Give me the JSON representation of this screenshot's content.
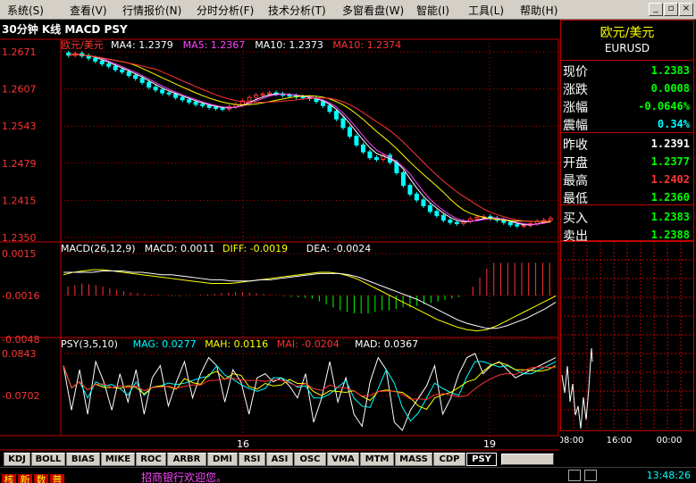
{
  "menu": [
    "系统(S)",
    "查看(V)",
    "行情报价(N)",
    "分时分析(F)",
    "技术分析(T)",
    "多窗看盘(W)",
    "智能(I)",
    "工具(L)",
    "帮助(H)"
  ],
  "chart_title": "30分钟 K线 MACD PSY",
  "price_panel": {
    "name": "欧元/美元",
    "legend": [
      {
        "label": "MA4: 1.2379",
        "color": "#ffffff"
      },
      {
        "label": "MA5: 1.2367",
        "color": "#ff44ff"
      },
      {
        "label": "MA10: 1.2373",
        "color": "#ffffff"
      },
      {
        "label": "MA10: 1.2374",
        "color": "#ff3333"
      }
    ],
    "y_ticks": [
      "1.2671",
      "1.2607",
      "1.2543",
      "1.2479",
      "1.2415",
      "1.2350"
    ],
    "ylim": [
      1.235,
      1.2671
    ]
  },
  "macd_panel": {
    "legend": [
      {
        "label": "MACD(26,12,9)",
        "color": "#ffffff"
      },
      {
        "label": "MACD: 0.0011",
        "color": "#ffffff"
      },
      {
        "label": "DIFF: -0.0019",
        "color": "#ffff00"
      },
      {
        "label": "DEA: -0.0024",
        "color": "#ffffff"
      }
    ],
    "y_ticks": [
      "0.0015",
      "-0.0016",
      "-0.0048"
    ]
  },
  "psy_panel": {
    "legend": [
      {
        "label": "PSY(3,5,10)",
        "color": "#ffffff"
      },
      {
        "label": "MAG: 0.0277",
        "color": "#00ffff"
      },
      {
        "label": "MAH: 0.0116",
        "color": "#ffff00"
      },
      {
        "label": "MAI: -0.0204",
        "color": "#ff3333"
      },
      {
        "label": "MAD: 0.0367",
        "color": "#ffffff"
      }
    ],
    "y_ticks": [
      "0.0843",
      "-0.0702"
    ]
  },
  "x_labels": [
    "16",
    "19"
  ],
  "info": {
    "name_cn": "欧元/美元",
    "name_en": "EURUSD",
    "rows": [
      {
        "k": "现价",
        "v": "1.2383",
        "color": "#00ff00"
      },
      {
        "k": "涨跌",
        "v": "0.0008",
        "color": "#00ff00"
      },
      {
        "k": "涨幅",
        "v": "-0.0646%",
        "color": "#00ff00"
      },
      {
        "k": "震幅",
        "v": "0.34%",
        "color": "#00ffff"
      },
      {
        "k": "昨收",
        "v": "1.2391",
        "color": "#ffffff"
      },
      {
        "k": "开盘",
        "v": "1.2377",
        "color": "#00ff00"
      },
      {
        "k": "最高",
        "v": "1.2402",
        "color": "#ff3333"
      },
      {
        "k": "最低",
        "v": "1.2360",
        "color": "#00ff00"
      },
      {
        "k": "买入",
        "v": "1.2383",
        "color": "#00ff00"
      },
      {
        "k": "卖出",
        "v": "1.2388",
        "color": "#00ff00"
      }
    ]
  },
  "mini_chart": {
    "x_labels": [
      "08:00",
      "16:00",
      "00:00"
    ]
  },
  "tabs": [
    "KDJ",
    "BOLL",
    "BIAS",
    "MIKE",
    "ROC",
    "ARBR",
    "DMI",
    "RSI",
    "ASI",
    "OSC",
    "VMA",
    "MTM",
    "MASS",
    "CDP",
    "PSY"
  ],
  "active_tab": "PSY",
  "status": {
    "badges": [
      "核",
      "新",
      "数",
      "普"
    ],
    "marquee": "招商银行欢迎您。",
    "time": "13:48:26"
  },
  "colors": {
    "up": "#ff3333",
    "down": "#00ffff",
    "grid": "#c00000",
    "axis_text": "#ff3333"
  },
  "chart_data": {
    "type": "candlestick",
    "title": "30分钟 K线 MACD PSY",
    "ylim": [
      1.235,
      1.2671
    ],
    "close": [
      1.2665,
      1.2668,
      1.2664,
      1.266,
      1.2655,
      1.265,
      1.2646,
      1.264,
      1.2636,
      1.263,
      1.2625,
      1.2618,
      1.261,
      1.2605,
      1.26,
      1.2598,
      1.2592,
      1.2588,
      1.2584,
      1.258,
      1.2578,
      1.2575,
      1.2573,
      1.2572,
      1.2576,
      1.258,
      1.2586,
      1.2592,
      1.2596,
      1.2598,
      1.26,
      1.2598,
      1.2596,
      1.2595,
      1.2593,
      1.2592,
      1.259,
      1.2585,
      1.2578,
      1.2568,
      1.2555,
      1.254,
      1.2525,
      1.251,
      1.2498,
      1.2488,
      1.2485,
      1.2492,
      1.248,
      1.2462,
      1.244,
      1.2425,
      1.2415,
      1.2405,
      1.2395,
      1.2388,
      1.238,
      1.2376,
      1.2374,
      1.2378,
      1.2382,
      1.2385,
      1.2386,
      1.2383,
      1.238,
      1.2376,
      1.2372,
      1.237,
      1.2371,
      1.2374,
      1.2378,
      1.238,
      1.2383
    ],
    "macd_hist": [
      0.0003,
      0.00035,
      0.0004,
      0.00038,
      0.00035,
      0.0003,
      0.00025,
      0.0002,
      0.00015,
      0.0001,
      8e-05,
      5e-05,
      3e-05,
      2e-05,
      0,
      -2e-05,
      -2e-05,
      -1e-05,
      0,
      2e-05,
      4e-05,
      6e-05,
      8e-05,
      0.0001,
      0.00012,
      0.00012,
      0.0001,
      8e-05,
      5e-05,
      2e-05,
      0,
      -2e-05,
      -4e-05,
      -6e-05,
      -8e-05,
      -0.0001,
      -0.0002,
      -0.0003,
      -0.0004,
      -0.0005,
      -0.00055,
      -0.0006,
      -0.0006,
      -0.0006,
      -0.00055,
      -0.0005,
      -0.0005,
      -0.00045,
      -0.0004,
      -0.0004,
      -0.00035,
      -0.0003,
      -0.00025,
      -0.0002,
      -0.00015,
      -0.0001,
      -5e-05,
      0,
      0.0003,
      0.0006,
      0.0009,
      0.0011,
      0.0011,
      0.0011,
      0.0011,
      0.0011,
      0.0011,
      0.0011,
      0.0011,
      0.0011
    ],
    "diff": [
      -0.0002,
      0,
      0.0001,
      0.0002,
      0.0002,
      0.0001,
      0,
      -0.0001,
      -0.0002,
      -0.0003,
      -0.0004,
      -0.0005,
      -0.0006,
      -0.0007,
      -0.0008,
      -0.0009,
      -0.0009,
      -0.0009,
      -0.0008,
      -0.0007,
      -0.0006,
      -0.0005,
      -0.0004,
      -0.0003,
      -0.0002,
      -0.0001,
      0,
      0,
      -0.0001,
      -0.0003,
      -0.0006,
      -0.001,
      -0.0014,
      -0.0018,
      -0.0022,
      -0.0026,
      -0.003,
      -0.0034,
      -0.0038,
      -0.0041,
      -0.0044,
      -0.0046,
      -0.0047,
      -0.0046,
      -0.0043,
      -0.0039,
      -0.0035,
      -0.0031,
      -0.0027,
      -0.0023,
      -0.0019
    ],
    "dea": [
      0,
      0,
      0,
      0,
      0.0001,
      0.0001,
      0.0001,
      0,
      0,
      -0.0001,
      -0.0002,
      -0.0002,
      -0.0003,
      -0.0004,
      -0.0005,
      -0.0006,
      -0.0006,
      -0.0007,
      -0.0007,
      -0.0007,
      -0.0006,
      -0.0006,
      -0.0005,
      -0.0004,
      -0.0003,
      -0.0002,
      -0.0001,
      -0.0001,
      -0.0001,
      -0.0002,
      -0.0004,
      -0.0007,
      -0.001,
      -0.0013,
      -0.0016,
      -0.0019,
      -0.0022,
      -0.0026,
      -0.003,
      -0.0034,
      -0.0038,
      -0.0041,
      -0.0043,
      -0.0045,
      -0.0045,
      -0.0043,
      -0.004,
      -0.0037,
      -0.0033,
      -0.0029,
      -0.0024
    ],
    "psy": [
      0.06,
      -0.05,
      0.05,
      -0.06,
      0.07,
      0.02,
      -0.05,
      0.04,
      -0.03,
      0.05,
      -0.06,
      0.03,
      0.06,
      -0.04,
      0.02,
      0.07,
      -0.02,
      0.04,
      0.08,
      0.06,
      -0.03,
      0.05,
      0.02,
      -0.06,
      0.03,
      0.04,
      0.02,
      0.03,
      0.01,
      -0.02,
      0.04,
      -0.08,
      -0.02,
      0.07,
      -0.03,
      0.03,
      -0.06,
      -0.09,
      0.02,
      0.08,
      0.05,
      -0.08,
      -0.1,
      -0.05,
      -0.02,
      0.01,
      0.06,
      -0.06,
      -0.02,
      0.04,
      0.08,
      0.09,
      0.04,
      0.06,
      0.07,
      0.05,
      0.03,
      0.04,
      0.05,
      0.06,
      0.07,
      0.08
    ],
    "x_labels": [
      "16",
      "19"
    ]
  }
}
